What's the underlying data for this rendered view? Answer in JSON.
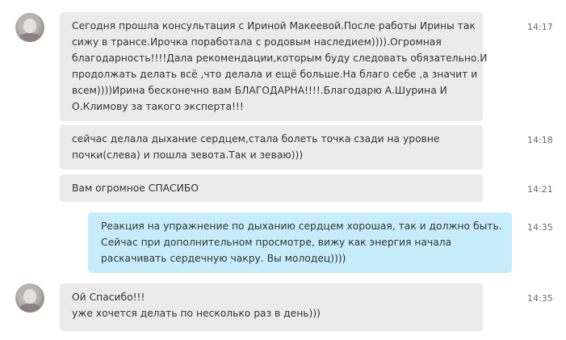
{
  "messages": [
    {
      "lines": [
        "Сегодня прошла консультация с Ириной Макеевой.После работы Ирины так",
        "сижу в трансе.Ирочка поработала с  родовым наследием)))).Огромная",
        "благодарность!!!!Дала рекомендации,которым буду следовать обязательно.И",
        "продолжать делать всё ,что делала и ещё больше.На благо себе ,а значит и",
        "всем))))Ирина бесконечно вам БЛАГОДАРНА!!!!.Благодарю А.Шурина И",
        "О.Климову за такого  эксперта!!!"
      ],
      "time": "14:17"
    },
    {
      "lines": [
        "сейчас делала дыхание сердцем,стала болеть точка сзади на уровне",
        "почки(слева) и пошла зевота.Так и зеваю)))"
      ],
      "time": "14:18"
    },
    {
      "lines": [
        "Вам огромное СПАСИБО"
      ],
      "time": "14:21"
    },
    {
      "lines": [
        "Реакция на упражнение по дыханию сердцем хорошая, так и должно быть.",
        "Сейчас при дополнительном просмотре, вижу как энергия начала",
        "раскачивать сердечную чакру. Вы молодец))))"
      ],
      "time": "14:35"
    },
    {
      "lines": [
        "Ой Спасибо!!!",
        "уже хочется делать по несколько раз в день)))"
      ],
      "time": "14:35"
    }
  ]
}
